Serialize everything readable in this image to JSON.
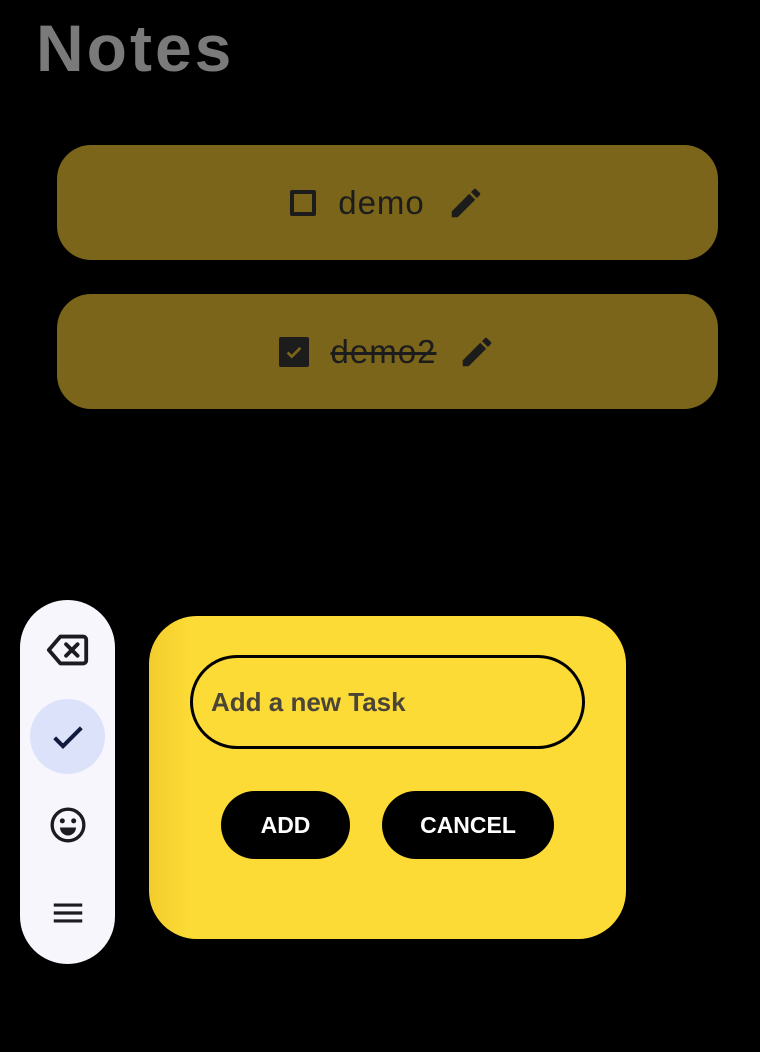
{
  "header": {
    "title": "Notes"
  },
  "tasks": [
    {
      "text": "demo",
      "completed": false
    },
    {
      "text": "demo2",
      "completed": true
    }
  ],
  "toolbar": {
    "items": [
      {
        "icon": "backspace-icon",
        "active": false
      },
      {
        "icon": "check-icon",
        "active": true
      },
      {
        "icon": "emoji-icon",
        "active": false
      },
      {
        "icon": "menu-icon",
        "active": false
      }
    ]
  },
  "dialog": {
    "input_placeholder": "Add a new Task",
    "input_value": "",
    "add_label": "ADD",
    "cancel_label": "CANCEL"
  },
  "colors": {
    "background": "#000000",
    "card": "#7a651a",
    "dialog": "#fddb36",
    "title": "#7a7a7a",
    "toolbar": "#f7f6fd",
    "toolbar_active": "#dbe2fa"
  }
}
